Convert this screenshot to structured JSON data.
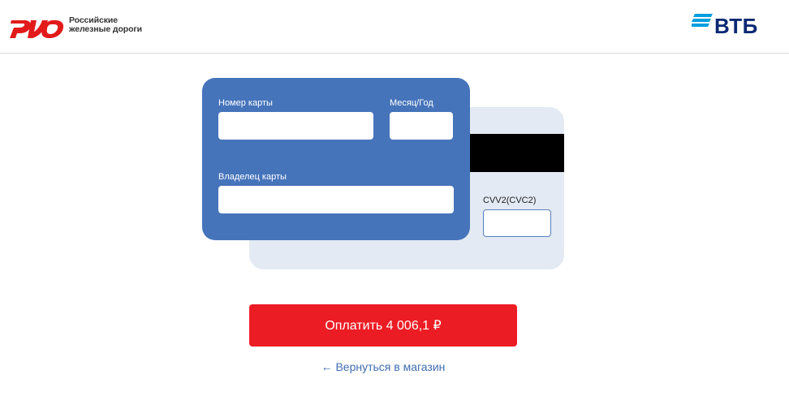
{
  "header": {
    "rzd_logo": {
      "line1": "Российские",
      "line2": "железные дороги",
      "color": "#e21a1a"
    },
    "vtb_logo": {
      "text": "ВТБ",
      "color": "#0a2973",
      "lines_color": "#009fdf"
    }
  },
  "card_front": {
    "color": "#4674bb",
    "card_number": {
      "label": "Номер карты",
      "value": ""
    },
    "expiry": {
      "label": "Месяц/Год",
      "value": ""
    },
    "holder": {
      "label": "Владелец карты",
      "value": ""
    }
  },
  "card_back": {
    "color": "#e3eaf3",
    "cvv": {
      "label": "CVV2(CVC2)",
      "value": ""
    }
  },
  "pay_button": {
    "label": "Оплатить 4 006,1 ₽",
    "color": "#ec1c24"
  },
  "back_link": {
    "label": "← Вернуться в магазин"
  }
}
